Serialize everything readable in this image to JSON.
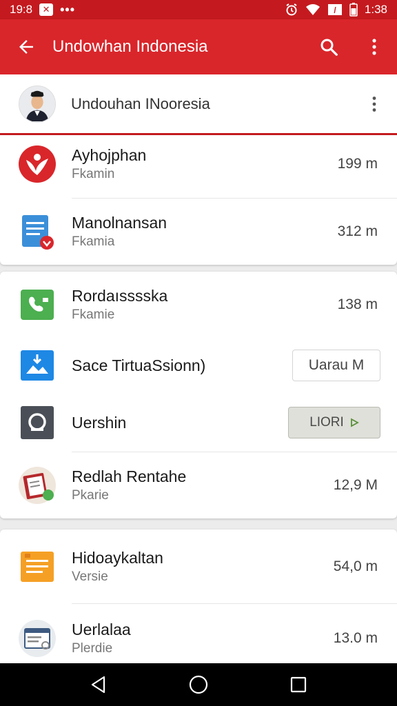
{
  "status_bar": {
    "time_left": "19:8",
    "time_right": "1:38",
    "notification_icon": "x-notification-icon",
    "more_dots": "•••"
  },
  "app_bar": {
    "title": "Undowhan Indonesia",
    "color": "#d9262b"
  },
  "profile": {
    "name": "Undouhan INooresia"
  },
  "cards": [
    {
      "rows": [
        {
          "title": "Ayhojphan",
          "subtitle": "Fkamin",
          "size": "199 m",
          "icon": "red-bird-logo-icon"
        },
        {
          "title": "Manolnansan",
          "subtitle": "Fkamia",
          "size": "312 m",
          "icon": "document-download-icon"
        }
      ]
    },
    {
      "rows": [
        {
          "title": "Rordaısssska",
          "subtitle": "Fkamie",
          "size": "138 m",
          "icon": "green-phone-icon"
        },
        {
          "title": "Sace TirtuaSsionn)",
          "button": "Uarau M",
          "icon": "blue-image-download-icon"
        },
        {
          "title": "Uershin",
          "button": "LIORI",
          "icon": "dark-app-icon"
        },
        {
          "title": "Redlah Rentahe",
          "subtitle": "Pkarie",
          "size": "12,9 M",
          "icon": "red-book-icon"
        }
      ]
    },
    {
      "rows": [
        {
          "title": "Hidoaykaltan",
          "subtitle": "Versie",
          "size": "54,0 m",
          "icon": "orange-document-icon"
        },
        {
          "title": "Uerlalaa",
          "subtitle": "Plerdie",
          "size": "13.0 m",
          "icon": "browser-window-icon"
        }
      ]
    }
  ]
}
